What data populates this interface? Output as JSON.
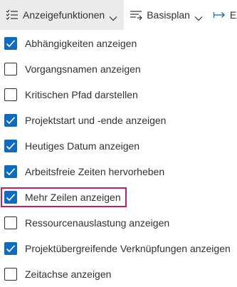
{
  "toolbar": {
    "display_label": "Anzeigefunktionen",
    "baseline_label": "Basisplan",
    "export_label": "Ex"
  },
  "menu_items": [
    {
      "label": "Abhängigkeiten anzeigen",
      "checked": true
    },
    {
      "label": "Vorgangsnamen anzeigen",
      "checked": false
    },
    {
      "label": "Kritischen Pfad darstellen",
      "checked": false
    },
    {
      "label": "Projektstart und -ende anzeigen",
      "checked": true
    },
    {
      "label": "Heutiges Datum anzeigen",
      "checked": true
    },
    {
      "label": "Arbeitsfreie Zeiten hervorheben",
      "checked": true
    },
    {
      "label": "Mehr Zeilen anzeigen",
      "checked": true,
      "focused": true
    },
    {
      "label": "Ressourcenauslastung anzeigen",
      "checked": false
    },
    {
      "label": "Projektübergreifende Verknüpfungen anzeigen",
      "checked": true
    },
    {
      "label": "Zeitachse anzeigen",
      "checked": false
    }
  ],
  "colors": {
    "checkbox_checked": "#0f6cbd",
    "focus_ring": "#b4236a",
    "active_button_bg": "#ebebeb"
  },
  "icons": {
    "display": "checklist-icon",
    "baseline": "baseline-lines-icon",
    "export": "arrow-right-bar-icon",
    "dropdown": "chevron-down-icon"
  }
}
